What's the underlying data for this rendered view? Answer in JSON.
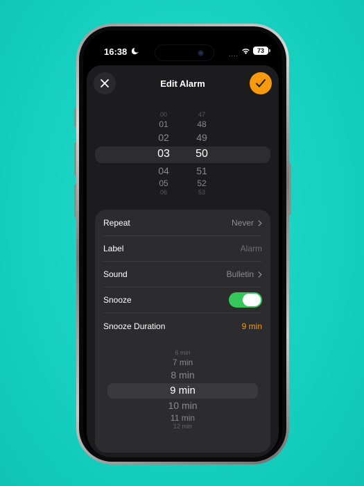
{
  "status_bar": {
    "time": "16:38",
    "signal": "....",
    "battery": "73"
  },
  "sheet": {
    "title": "Edit Alarm"
  },
  "time_picker": {
    "hours": [
      "00",
      "01",
      "02",
      "03",
      "04",
      "05",
      "06"
    ],
    "minutes": [
      "47",
      "48",
      "49",
      "50",
      "51",
      "52",
      "53"
    ],
    "selected_hour": "03",
    "selected_minute": "50"
  },
  "settings": {
    "repeat": {
      "label": "Repeat",
      "value": "Never"
    },
    "label": {
      "label": "Label",
      "value": "Alarm"
    },
    "sound": {
      "label": "Sound",
      "value": "Bulletin"
    },
    "snooze": {
      "label": "Snooze",
      "enabled": true
    },
    "snooze_duration": {
      "label": "Snooze Duration",
      "value": "9 min"
    }
  },
  "duration_picker": {
    "options": [
      "6 min",
      "7 min",
      "8 min",
      "9 min",
      "10 min",
      "11 min",
      "12 min"
    ],
    "selected": "9 min"
  },
  "colors": {
    "accent": "#f79a0e",
    "toggle_on": "#34c759",
    "background": "#1fd6c5"
  }
}
